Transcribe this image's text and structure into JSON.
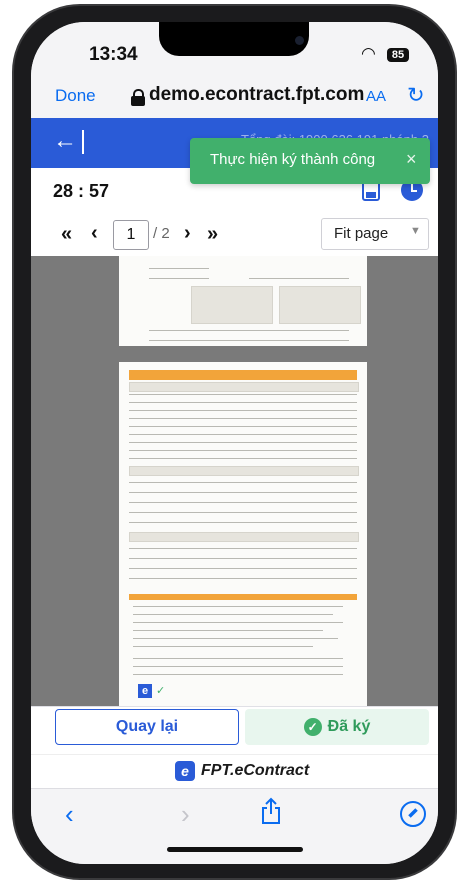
{
  "status": {
    "time": "13:34",
    "battery": "85"
  },
  "safari": {
    "done_label": "Done",
    "domain": "demo.econtract.fpt.com",
    "text_size_label": "AA"
  },
  "app": {
    "hotline": "Tổng đài: 1900 636 191 nhánh 3"
  },
  "toast": {
    "message": "Thực hiện ký thành công",
    "close_label": "×"
  },
  "timer": "28 : 57",
  "pager": {
    "current_page": "1",
    "total": "/ 2",
    "zoom": "Fit page"
  },
  "actions": {
    "back_label": "Quay lại",
    "signed_label": "Đã ký"
  },
  "brand": {
    "name": "FPT.eContract"
  },
  "colors": {
    "primary": "#2a5bd7",
    "success": "#41b06c",
    "ios_blue": "#0a6cf0",
    "doc_header": "#f2a43a"
  },
  "icons": [
    "back-arrow-icon",
    "lock-icon",
    "reload-icon",
    "save-icon",
    "clock-icon",
    "close-icon",
    "check-icon",
    "share-icon",
    "compass-icon",
    "chevron-left-icon",
    "chevron-right-icon"
  ]
}
